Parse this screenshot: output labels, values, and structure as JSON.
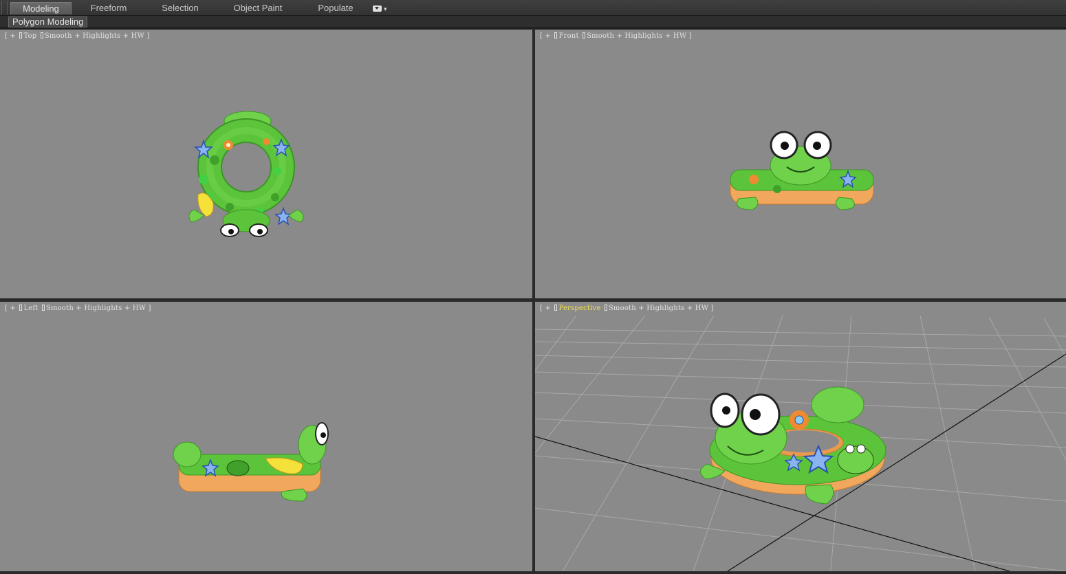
{
  "ribbon": {
    "tabs": [
      {
        "label": "Modeling",
        "active": true
      },
      {
        "label": "Freeform",
        "active": false
      },
      {
        "label": "Selection",
        "active": false
      },
      {
        "label": "Object Paint",
        "active": false
      },
      {
        "label": "Populate",
        "active": false
      }
    ],
    "panel_label": "Polygon Modeling",
    "dropdown_icon": "chevron-down-icon"
  },
  "viewports": {
    "top": {
      "plus": "+",
      "name": "Top",
      "shading": "Smooth + Highlights + HW"
    },
    "front": {
      "plus": "+",
      "name": "Front",
      "shading": "Smooth + Highlights + HW"
    },
    "left": {
      "plus": "+",
      "name": "Left",
      "shading": "Smooth + Highlights + HW"
    },
    "persp": {
      "plus": "+",
      "name": "Perspective",
      "shading": "Smooth + Highlights + HW",
      "active": true
    }
  },
  "colors": {
    "viewport_bg": "#8a8a8a",
    "active_label": "#f2e34a",
    "frog_green": "#5cc43a",
    "ring_orange": "#f0a65a"
  }
}
